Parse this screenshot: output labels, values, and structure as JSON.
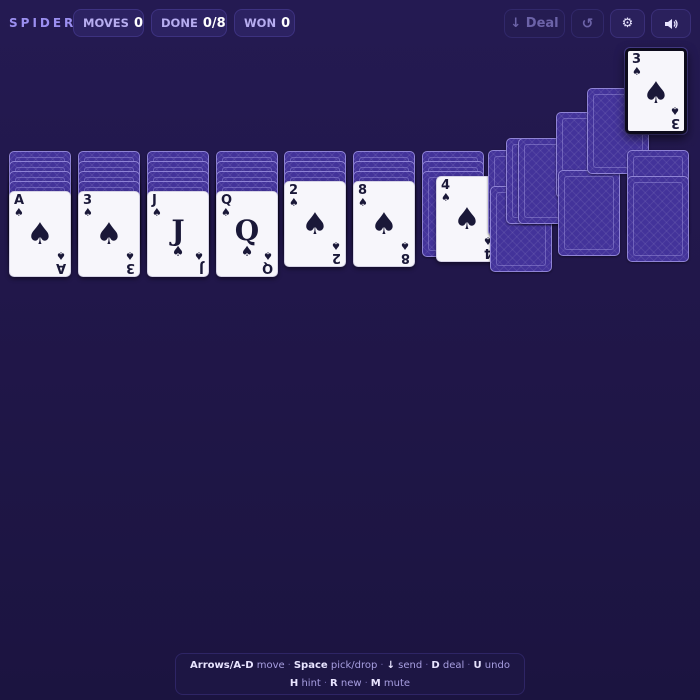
{
  "header": {
    "brand": "SPIDER",
    "stats": [
      {
        "label": "MOVES",
        "value": "0"
      },
      {
        "label": "DONE",
        "value": "0/8"
      },
      {
        "label": "WON",
        "value": "0"
      }
    ],
    "buttons": {
      "deal": "↓ Deal",
      "undo": "↺",
      "settings": "⚙",
      "sound": "🔊"
    }
  },
  "tableau": [
    {
      "face_down_count": 4,
      "face_up": [
        {
          "rank": "A",
          "suit": "♠"
        }
      ]
    },
    {
      "face_down_count": 4,
      "face_up": [
        {
          "rank": "3",
          "suit": "♠"
        }
      ]
    },
    {
      "face_down_count": 4,
      "face_up": [
        {
          "rank": "J",
          "suit": "♠"
        }
      ]
    },
    {
      "face_down_count": 4,
      "face_up": [
        {
          "rank": "Q",
          "suit": "♠"
        }
      ]
    },
    {
      "face_down_count": 3,
      "face_up": [
        {
          "rank": "2",
          "suit": "♠"
        }
      ]
    },
    {
      "face_down_count": 3,
      "face_up": [
        {
          "rank": "8",
          "suit": "♠"
        }
      ]
    },
    {
      "face_down_count": 3,
      "face_up": [
        {
          "rank": "4",
          "suit": "♠"
        }
      ]
    }
  ],
  "held_card": {
    "rank": "3",
    "suit": "♠"
  },
  "help": {
    "line1": [
      {
        "key": "Arrows/A-D",
        "action": "move"
      },
      {
        "key": "Space",
        "action": "pick/drop"
      },
      {
        "key": "↓",
        "action": "send"
      },
      {
        "key": "D",
        "action": "deal"
      },
      {
        "key": "U",
        "action": "undo"
      }
    ],
    "line2": [
      {
        "key": "H",
        "action": "hint"
      },
      {
        "key": "R",
        "action": "new"
      },
      {
        "key": "M",
        "action": "mute"
      }
    ]
  },
  "colors": {
    "background": "#221850",
    "card_back": "#43339a",
    "card_face": "#f7f6fb",
    "accent": "#9b8ff0"
  }
}
